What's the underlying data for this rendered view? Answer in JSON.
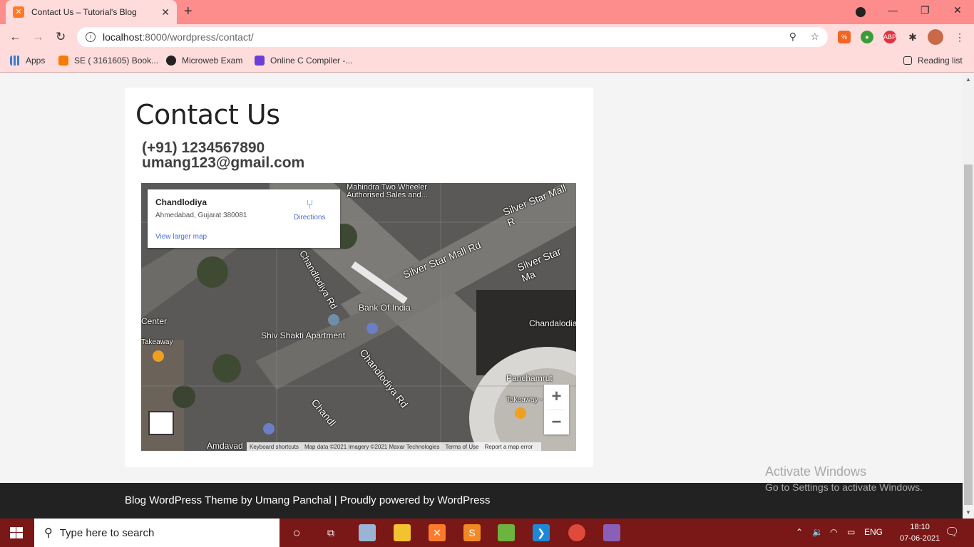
{
  "browser": {
    "tab_title": "Contact Us – Tutorial's Blog",
    "url_host": "localhost",
    "url_path": ":8000/wordpress/contact/",
    "bookmarks": [
      {
        "label": "Apps"
      },
      {
        "label": "SE ( 3161605) Book..."
      },
      {
        "label": "Microweb Exam"
      },
      {
        "label": "Online C Compiler -..."
      }
    ],
    "reading_list": "Reading list"
  },
  "page": {
    "heading": "Contact Us",
    "phone": "(+91) 1234567890",
    "email": "umang123@gmail.com"
  },
  "map": {
    "place_name": "Chandlodiya",
    "place_address": "Ahmedabad, Gujarat 380081",
    "directions": "Directions",
    "view_larger": "View larger map",
    "labels": {
      "mahindra": "Mahindra Two Wheeler",
      "mahindra2": "Authorised Sales and...",
      "silver1": "Silver Star Mall Rd",
      "silver2": "Silver Star Mall R",
      "silver3": "Silver Star Ma",
      "chandlodiya_rd": "Chandlodiya Rd",
      "chandlodiya_rd2": "Chandlodiya Rd",
      "bank": "Bank Of India",
      "shiv": "Shiv Shakti Apartment",
      "center": "Center",
      "takeaway": "Takeaway",
      "chandalodia": "Chandalodia",
      "panchamrut": "Panchamrut",
      "takeaway2": "Takeaway -",
      "amdavad": "Amdavad",
      "chandl": "Chandl"
    },
    "attribution": [
      "Keyboard shortcuts",
      "Map data ©2021 Imagery ©2021 Maxar Technologies",
      "Terms of Use",
      "Report a map error"
    ]
  },
  "footer": {
    "credit": "Blog WordPress Theme by Umang Panchal | Proudly powered by WordPress"
  },
  "watermark": {
    "line1": "Activate Windows",
    "line2": "Go to Settings to activate Windows."
  },
  "taskbar": {
    "search_placeholder": "Type here to search",
    "lang": "ENG",
    "time": "18:10",
    "date": "07-06-2021"
  }
}
